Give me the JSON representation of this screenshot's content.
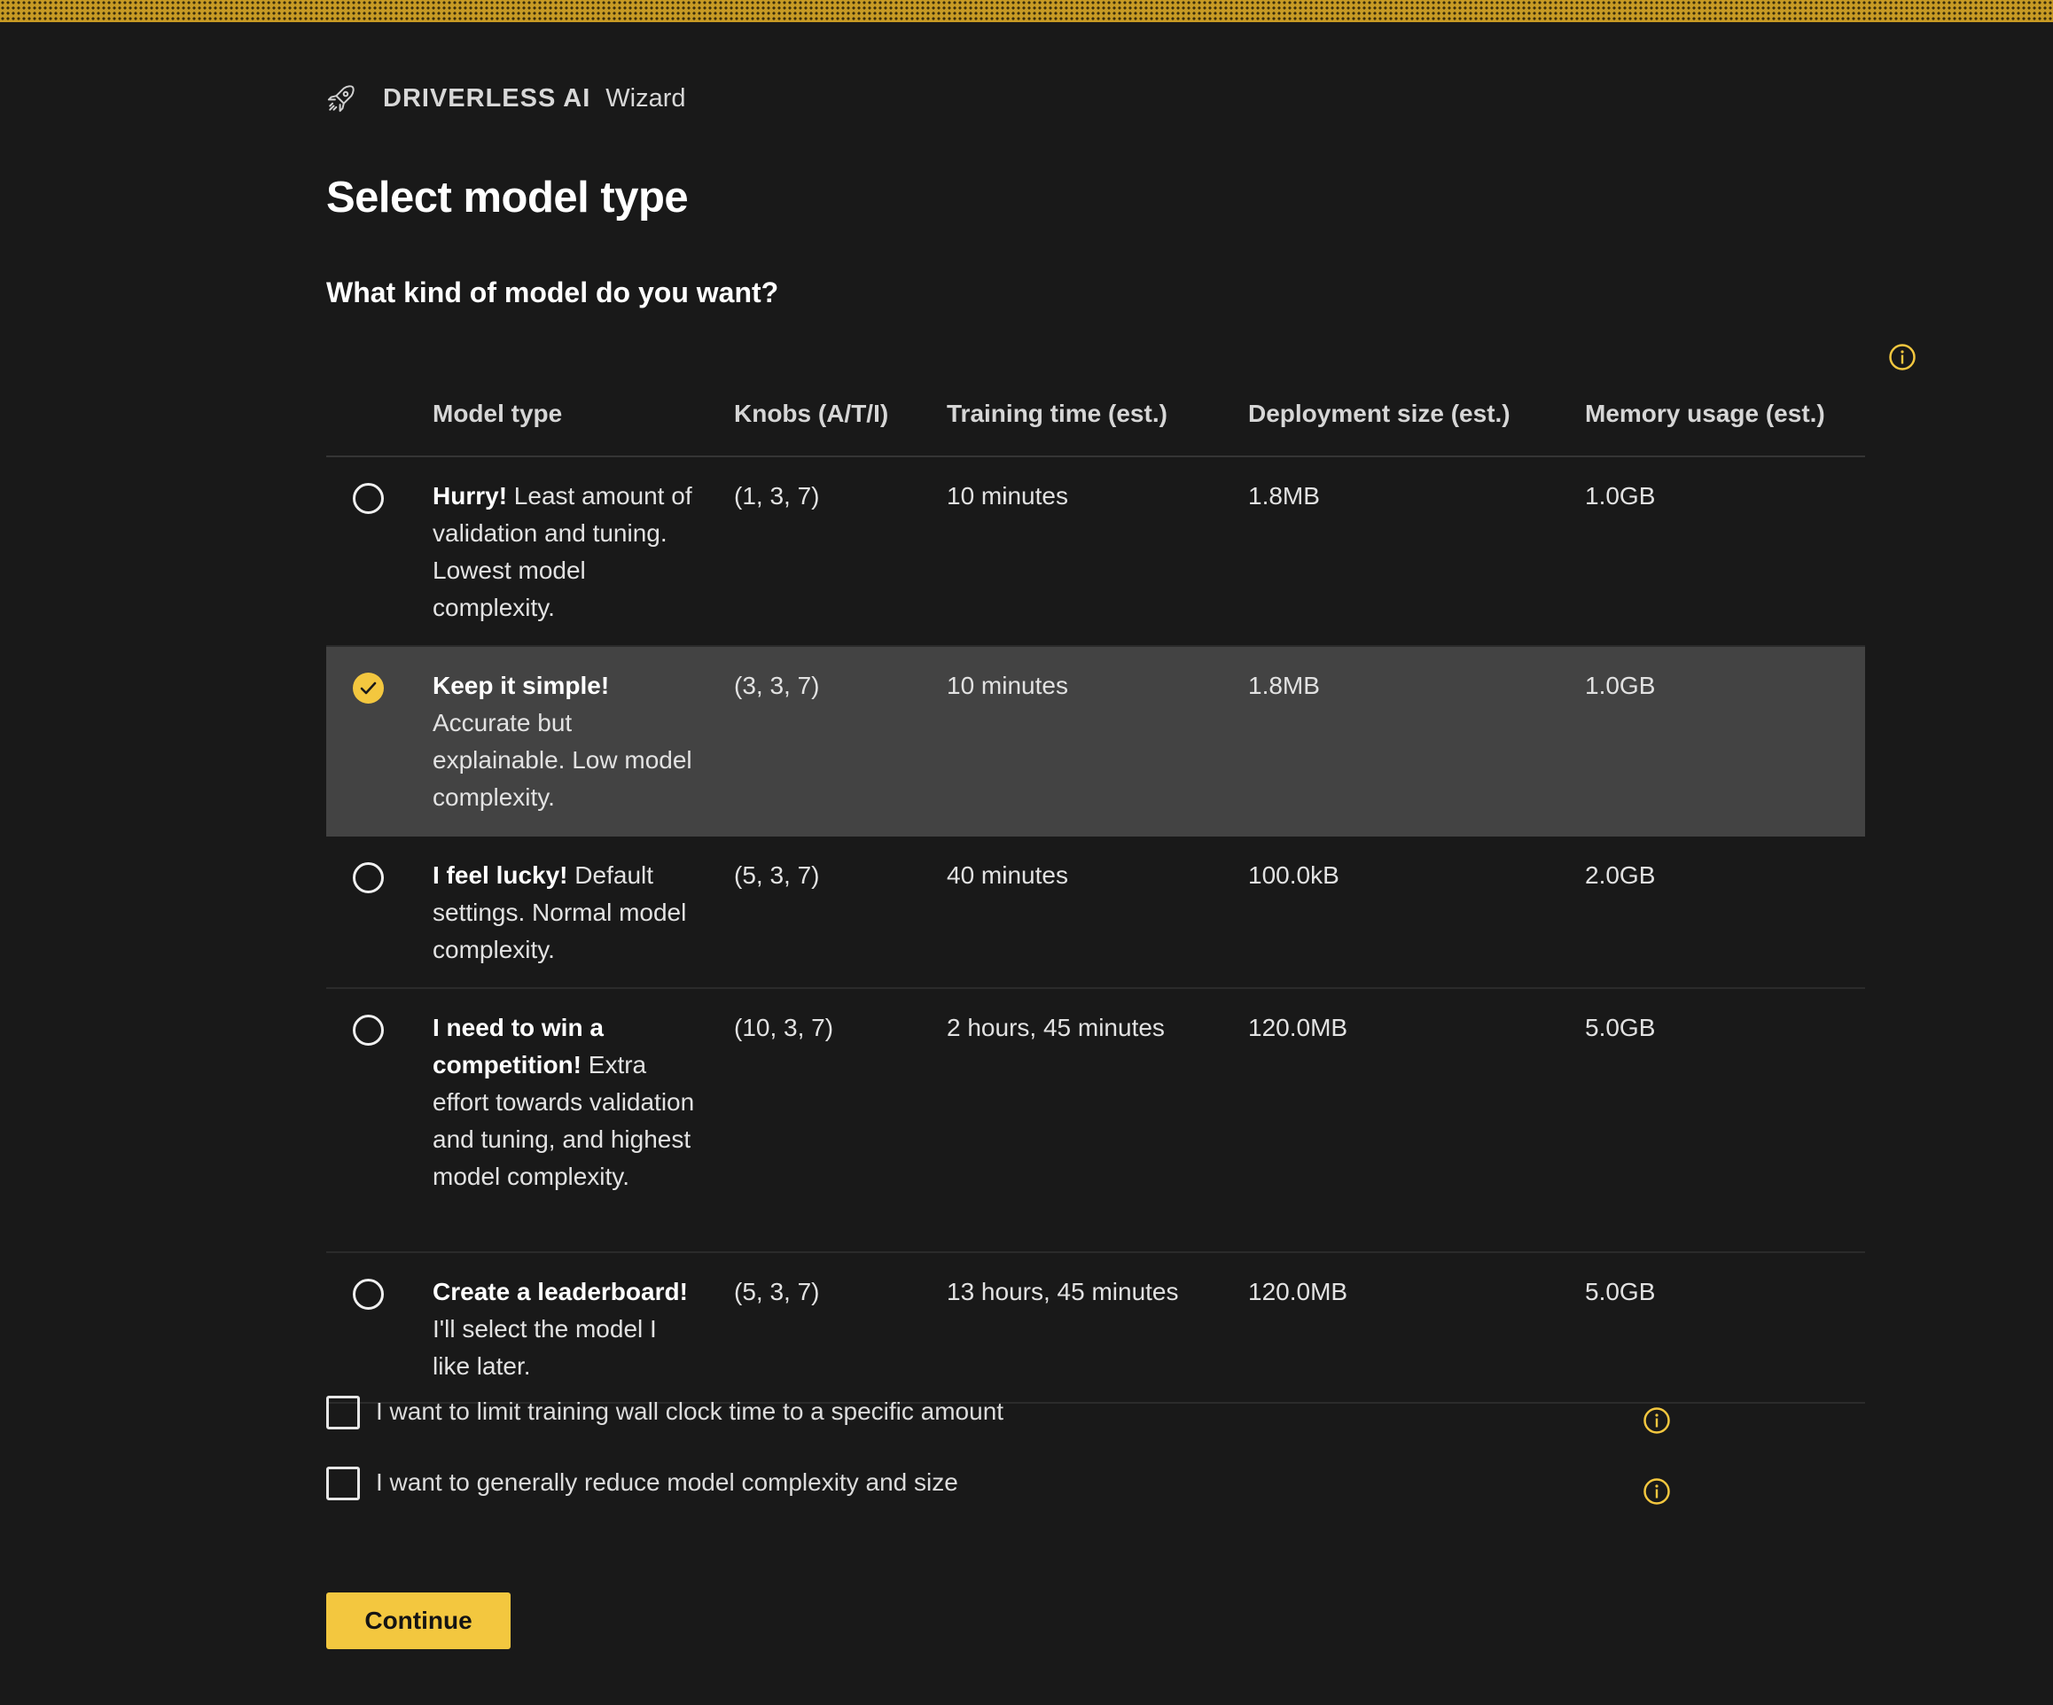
{
  "brand": {
    "name": "DRIVERLESS AI",
    "sub": "Wizard"
  },
  "title": "Select model type",
  "question": "What kind of model do you want?",
  "table": {
    "headers": {
      "model_type": "Model type",
      "knobs": "Knobs (A/T/I)",
      "training_time": "Training time (est.)",
      "deployment_size": "Deployment size (est.)",
      "memory_usage": "Memory usage (est.)"
    },
    "rows": [
      {
        "lead": "Hurry!",
        "desc": "Least amount of validation and tuning. Lowest model complexity.",
        "knobs": "(1, 3, 7)",
        "time": "10 minutes",
        "deploy": "1.8MB",
        "mem": "1.0GB",
        "selected": false
      },
      {
        "lead": "Keep it simple!",
        "desc": "Accurate but explainable. Low model complexity.",
        "knobs": "(3, 3, 7)",
        "time": "10 minutes",
        "deploy": "1.8MB",
        "mem": "1.0GB",
        "selected": true
      },
      {
        "lead": "I feel lucky!",
        "desc": "Default settings. Normal model complexity.",
        "knobs": "(5, 3, 7)",
        "time": "40 minutes",
        "deploy": "100.0kB",
        "mem": "2.0GB",
        "selected": false
      },
      {
        "lead": "I need to win a competition!",
        "desc": "Extra effort towards validation and tuning, and highest model complexity.",
        "knobs": "(10, 3, 7)",
        "time": "2 hours, 45 minutes",
        "deploy": "120.0MB",
        "mem": "5.0GB",
        "selected": false
      },
      {
        "lead": "Create a leaderboard!",
        "desc": "I'll select the model I like later.",
        "knobs": "(5, 3, 7)",
        "time": "13 hours, 45 minutes",
        "deploy": "120.0MB",
        "mem": "5.0GB",
        "selected": false
      }
    ]
  },
  "options": [
    {
      "label": "I want to limit training wall clock time to a specific amount",
      "checked": false
    },
    {
      "label": "I want to generally reduce model complexity and size",
      "checked": false
    }
  ],
  "continue_label": "Continue",
  "colors": {
    "accent": "#f3c73f",
    "background": "#191919",
    "selected_row": "#434343"
  },
  "icons": {
    "brand": "rocket-icon",
    "info": "info-icon",
    "selected": "check-circle-icon"
  }
}
